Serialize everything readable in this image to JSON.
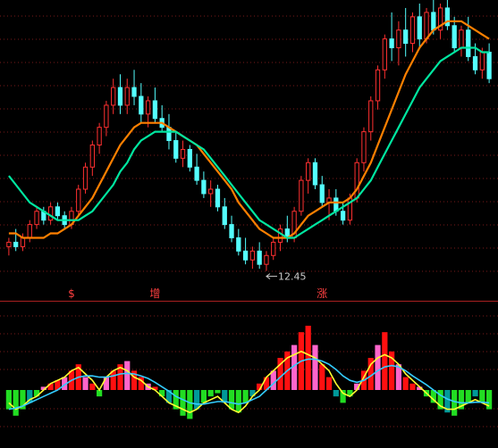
{
  "chart_data": [
    {
      "panel": "price",
      "type": "candlestick",
      "grid": "dotted-horizontal",
      "low_marker": {
        "value": 12.45,
        "index": 37,
        "label": "12.45"
      },
      "up_color": "#ff3030",
      "down_color": "#54ffff",
      "candles": [
        {
          "o": 13.0,
          "h": 13.2,
          "l": 12.8,
          "c": 13.1
        },
        {
          "o": 13.1,
          "h": 13.4,
          "l": 12.9,
          "c": 13.0
        },
        {
          "o": 13.0,
          "h": 13.3,
          "l": 12.9,
          "c": 13.2
        },
        {
          "o": 13.2,
          "h": 13.6,
          "l": 13.1,
          "c": 13.5
        },
        {
          "o": 13.5,
          "h": 13.9,
          "l": 13.4,
          "c": 13.8
        },
        {
          "o": 13.8,
          "h": 13.9,
          "l": 13.5,
          "c": 13.6
        },
        {
          "o": 13.6,
          "h": 14.0,
          "l": 13.5,
          "c": 13.9
        },
        {
          "o": 13.9,
          "h": 14.0,
          "l": 13.6,
          "c": 13.7
        },
        {
          "o": 13.7,
          "h": 13.8,
          "l": 13.4,
          "c": 13.5
        },
        {
          "o": 13.5,
          "h": 13.9,
          "l": 13.4,
          "c": 13.8
        },
        {
          "o": 13.8,
          "h": 14.4,
          "l": 13.7,
          "c": 14.3
        },
        {
          "o": 14.3,
          "h": 14.9,
          "l": 14.2,
          "c": 14.8
        },
        {
          "o": 14.8,
          "h": 15.4,
          "l": 14.6,
          "c": 15.3
        },
        {
          "o": 15.3,
          "h": 15.8,
          "l": 15.1,
          "c": 15.7
        },
        {
          "o": 15.7,
          "h": 16.3,
          "l": 15.5,
          "c": 16.2
        },
        {
          "o": 16.2,
          "h": 16.8,
          "l": 16.0,
          "c": 16.6
        },
        {
          "o": 16.6,
          "h": 16.9,
          "l": 16.0,
          "c": 16.2
        },
        {
          "o": 16.2,
          "h": 16.8,
          "l": 16.0,
          "c": 16.6
        },
        {
          "o": 16.6,
          "h": 17.0,
          "l": 16.2,
          "c": 16.4
        },
        {
          "o": 16.4,
          "h": 16.7,
          "l": 15.8,
          "c": 16.0
        },
        {
          "o": 16.0,
          "h": 16.4,
          "l": 15.7,
          "c": 16.3
        },
        {
          "o": 16.3,
          "h": 16.6,
          "l": 15.8,
          "c": 15.9
        },
        {
          "o": 15.9,
          "h": 16.2,
          "l": 15.6,
          "c": 15.7
        },
        {
          "o": 15.7,
          "h": 16.0,
          "l": 15.2,
          "c": 15.4
        },
        {
          "o": 15.4,
          "h": 15.6,
          "l": 14.9,
          "c": 15.0
        },
        {
          "o": 15.0,
          "h": 15.4,
          "l": 14.8,
          "c": 15.2
        },
        {
          "o": 15.2,
          "h": 15.3,
          "l": 14.7,
          "c": 14.8
        },
        {
          "o": 14.8,
          "h": 15.1,
          "l": 14.4,
          "c": 14.5
        },
        {
          "o": 14.5,
          "h": 14.7,
          "l": 14.1,
          "c": 14.2
        },
        {
          "o": 14.2,
          "h": 14.5,
          "l": 13.9,
          "c": 14.3
        },
        {
          "o": 14.3,
          "h": 14.4,
          "l": 13.8,
          "c": 13.9
        },
        {
          "o": 13.9,
          "h": 14.1,
          "l": 13.4,
          "c": 13.5
        },
        {
          "o": 13.5,
          "h": 13.7,
          "l": 13.1,
          "c": 13.2
        },
        {
          "o": 13.2,
          "h": 13.4,
          "l": 12.8,
          "c": 12.9
        },
        {
          "o": 12.9,
          "h": 13.2,
          "l": 12.6,
          "c": 12.7
        },
        {
          "o": 12.7,
          "h": 13.0,
          "l": 12.5,
          "c": 12.9
        },
        {
          "o": 12.9,
          "h": 13.1,
          "l": 12.5,
          "c": 12.6
        },
        {
          "o": 12.6,
          "h": 12.9,
          "l": 12.45,
          "c": 12.8
        },
        {
          "o": 12.8,
          "h": 13.2,
          "l": 12.7,
          "c": 13.1
        },
        {
          "o": 13.1,
          "h": 13.5,
          "l": 12.9,
          "c": 13.4
        },
        {
          "o": 13.4,
          "h": 13.7,
          "l": 13.1,
          "c": 13.2
        },
        {
          "o": 13.2,
          "h": 13.9,
          "l": 13.1,
          "c": 13.8
        },
        {
          "o": 13.8,
          "h": 14.6,
          "l": 13.7,
          "c": 14.5
        },
        {
          "o": 14.5,
          "h": 15.0,
          "l": 14.2,
          "c": 14.9
        },
        {
          "o": 14.9,
          "h": 15.0,
          "l": 14.3,
          "c": 14.4
        },
        {
          "o": 14.4,
          "h": 14.6,
          "l": 13.9,
          "c": 14.0
        },
        {
          "o": 14.0,
          "h": 14.3,
          "l": 13.6,
          "c": 14.1
        },
        {
          "o": 14.1,
          "h": 14.3,
          "l": 13.7,
          "c": 13.8
        },
        {
          "o": 13.8,
          "h": 14.0,
          "l": 13.5,
          "c": 13.6
        },
        {
          "o": 13.6,
          "h": 14.2,
          "l": 13.5,
          "c": 14.1
        },
        {
          "o": 14.1,
          "h": 15.0,
          "l": 14.0,
          "c": 14.9
        },
        {
          "o": 14.9,
          "h": 15.7,
          "l": 14.7,
          "c": 15.6
        },
        {
          "o": 15.6,
          "h": 16.4,
          "l": 15.4,
          "c": 16.3
        },
        {
          "o": 16.3,
          "h": 17.1,
          "l": 16.1,
          "c": 17.0
        },
        {
          "o": 17.0,
          "h": 17.8,
          "l": 16.8,
          "c": 17.7
        },
        {
          "o": 17.7,
          "h": 18.3,
          "l": 17.2,
          "c": 17.5
        },
        {
          "o": 17.5,
          "h": 18.1,
          "l": 17.1,
          "c": 17.9
        },
        {
          "o": 17.9,
          "h": 18.4,
          "l": 17.3,
          "c": 17.6
        },
        {
          "o": 17.6,
          "h": 18.3,
          "l": 17.4,
          "c": 18.2
        },
        {
          "o": 18.2,
          "h": 18.5,
          "l": 17.5,
          "c": 17.7
        },
        {
          "o": 17.7,
          "h": 18.4,
          "l": 17.6,
          "c": 18.3
        },
        {
          "o": 18.3,
          "h": 18.6,
          "l": 17.8,
          "c": 17.9
        },
        {
          "o": 17.9,
          "h": 18.5,
          "l": 17.7,
          "c": 18.4
        },
        {
          "o": 18.4,
          "h": 18.6,
          "l": 17.9,
          "c": 18.0
        },
        {
          "o": 18.0,
          "h": 18.2,
          "l": 17.4,
          "c": 17.5
        },
        {
          "o": 17.5,
          "h": 18.0,
          "l": 17.3,
          "c": 17.9
        },
        {
          "o": 17.9,
          "h": 18.2,
          "l": 17.2,
          "c": 17.3
        },
        {
          "o": 17.3,
          "h": 17.6,
          "l": 16.9,
          "c": 17.0
        },
        {
          "o": 17.0,
          "h": 17.5,
          "l": 16.8,
          "c": 17.4
        },
        {
          "o": 17.4,
          "h": 17.6,
          "l": 16.7,
          "c": 16.8
        }
      ],
      "series": [
        {
          "color": "#ff8000",
          "values": [
            13.3,
            13.3,
            13.2,
            13.2,
            13.2,
            13.2,
            13.3,
            13.3,
            13.4,
            13.5,
            13.7,
            13.9,
            14.1,
            14.4,
            14.7,
            15.0,
            15.3,
            15.5,
            15.7,
            15.8,
            15.8,
            15.8,
            15.8,
            15.7,
            15.6,
            15.5,
            15.4,
            15.3,
            15.1,
            14.9,
            14.7,
            14.5,
            14.3,
            14.0,
            13.8,
            13.6,
            13.4,
            13.3,
            13.2,
            13.2,
            13.2,
            13.3,
            13.5,
            13.7,
            13.8,
            13.9,
            14.0,
            14.0,
            14.0,
            14.1,
            14.3,
            14.6,
            14.9,
            15.3,
            15.7,
            16.1,
            16.5,
            16.9,
            17.2,
            17.5,
            17.7,
            17.9,
            18.0,
            18.1,
            18.1,
            18.1,
            18.0,
            17.9,
            17.8,
            17.7
          ]
        },
        {
          "color": "#00e6a0",
          "values": [
            14.6,
            14.4,
            14.2,
            14.0,
            13.9,
            13.8,
            13.7,
            13.6,
            13.6,
            13.6,
            13.6,
            13.7,
            13.8,
            14.0,
            14.2,
            14.4,
            14.7,
            14.9,
            15.2,
            15.4,
            15.5,
            15.6,
            15.6,
            15.6,
            15.6,
            15.5,
            15.4,
            15.3,
            15.2,
            15.0,
            14.8,
            14.6,
            14.4,
            14.2,
            14.0,
            13.8,
            13.6,
            13.5,
            13.4,
            13.3,
            13.2,
            13.2,
            13.3,
            13.4,
            13.5,
            13.6,
            13.7,
            13.8,
            13.9,
            14.0,
            14.1,
            14.3,
            14.5,
            14.8,
            15.1,
            15.4,
            15.7,
            16.0,
            16.3,
            16.6,
            16.8,
            17.0,
            17.2,
            17.3,
            17.4,
            17.5,
            17.5,
            17.5,
            17.4,
            17.4
          ]
        }
      ]
    },
    {
      "panel": "indicator",
      "type": "bar",
      "annotations": [
        {
          "text": "$",
          "index": 9,
          "color": "#ff4040"
        },
        {
          "text": "增",
          "index": 21,
          "color": "#ff4040"
        },
        {
          "text": "涨",
          "index": 45,
          "color": "#ff4040"
        }
      ],
      "values": [
        -3,
        -4,
        -3,
        -2,
        -1,
        0.5,
        1,
        1.5,
        2,
        3,
        4,
        2,
        1,
        -1,
        2,
        3,
        4,
        4.5,
        3,
        2,
        1,
        0.5,
        -1,
        -2,
        -3,
        -4,
        -4.5,
        -3,
        -2,
        -1,
        -0.5,
        -2,
        -3,
        -3.5,
        -2,
        -1,
        1,
        2,
        3,
        5,
        6,
        7,
        9,
        10,
        7,
        4,
        2,
        -1,
        -2,
        -1,
        1,
        3,
        5,
        7,
        9,
        6,
        4,
        2,
        1,
        0.5,
        -1,
        -2,
        -3,
        -3.5,
        -4,
        -3,
        -2,
        -1,
        -2,
        -3
      ],
      "colors": {
        "pos_strong": "#ff1010",
        "pos_light": "#ff66cc",
        "neg": "#22dd22",
        "neg_light": "#009999"
      },
      "series": [
        {
          "color": "#ffff30",
          "values": [
            -2,
            -3,
            -2.5,
            -1.5,
            -1,
            0,
            1,
            1.5,
            2,
            3,
            3.5,
            2.5,
            1.5,
            0,
            2,
            3,
            3.5,
            3,
            2,
            1.5,
            0.5,
            0,
            -1,
            -2,
            -2.5,
            -3,
            -3.5,
            -3,
            -2,
            -1.5,
            -1,
            -2,
            -3,
            -3.5,
            -2.5,
            -1,
            0,
            2,
            3,
            4,
            5,
            5.5,
            6,
            5.5,
            5,
            4,
            3,
            1,
            -0.5,
            -1,
            0,
            2,
            4,
            5,
            5.5,
            5,
            4,
            2.5,
            1.5,
            0.5,
            -0.5,
            -1.5,
            -2.5,
            -3,
            -3,
            -2.5,
            -2,
            -1.5,
            -2,
            -2.5
          ]
        },
        {
          "color": "#33ccff",
          "values": [
            -3,
            -2.8,
            -2.5,
            -2,
            -1.5,
            -1,
            -0.5,
            0,
            0.8,
            1.5,
            2,
            2.2,
            2.2,
            2,
            2,
            2.2,
            2.5,
            2.6,
            2.5,
            2.2,
            1.8,
            1.2,
            0.5,
            -0.2,
            -1,
            -1.5,
            -2,
            -2.2,
            -2.2,
            -2,
            -1.8,
            -1.8,
            -2,
            -2.2,
            -2,
            -1.5,
            -1,
            0,
            1,
            2,
            3,
            3.8,
            4.5,
            4.8,
            4.8,
            4.5,
            4,
            3.2,
            2.2,
            1.5,
            1.2,
            1.5,
            2.2,
            3,
            3.6,
            3.8,
            3.6,
            3,
            2.2,
            1.5,
            0.8,
            0,
            -0.8,
            -1.4,
            -1.8,
            -2,
            -2,
            -1.9,
            -1.9,
            -2
          ]
        }
      ]
    }
  ]
}
